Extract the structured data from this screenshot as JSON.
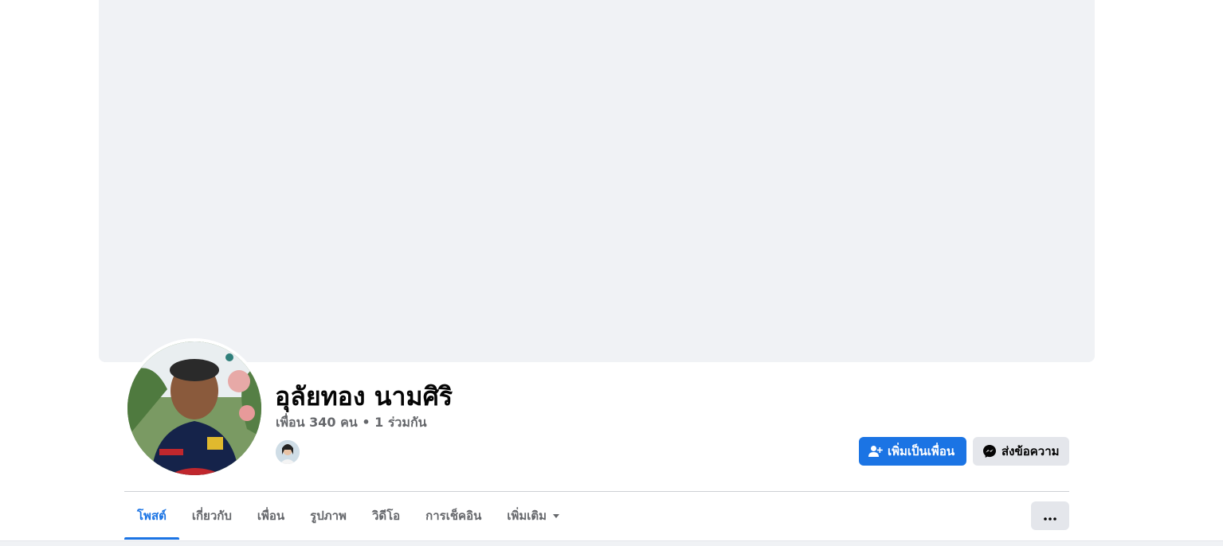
{
  "profile": {
    "name": "อุลัยทอง นามศิริ",
    "friends_summary": "เพื่อน 340 คน • 1 ร่วมกัน"
  },
  "actions": {
    "add_friend_label": "เพิ่มเป็นเพื่อน",
    "message_label": "ส่งข้อความ"
  },
  "tabs": [
    {
      "label": "โพสต์",
      "active": true
    },
    {
      "label": "เกี่ยวกับ",
      "active": false
    },
    {
      "label": "เพื่อน",
      "active": false
    },
    {
      "label": "รูปภาพ",
      "active": false
    },
    {
      "label": "วิดีโอ",
      "active": false
    },
    {
      "label": "การเช็คอิน",
      "active": false
    },
    {
      "label": "เพิ่มเติม",
      "active": false
    }
  ],
  "icons": {
    "add_friend": "person-plus-icon",
    "messenger": "messenger-icon",
    "more": "more-dots-icon",
    "dropdown": "caret-down-icon"
  },
  "colors": {
    "primary": "#1b74e4",
    "secondary_button": "#e4e6eb",
    "cover_placeholder": "#f0f2f5",
    "muted_text": "#65676b"
  }
}
